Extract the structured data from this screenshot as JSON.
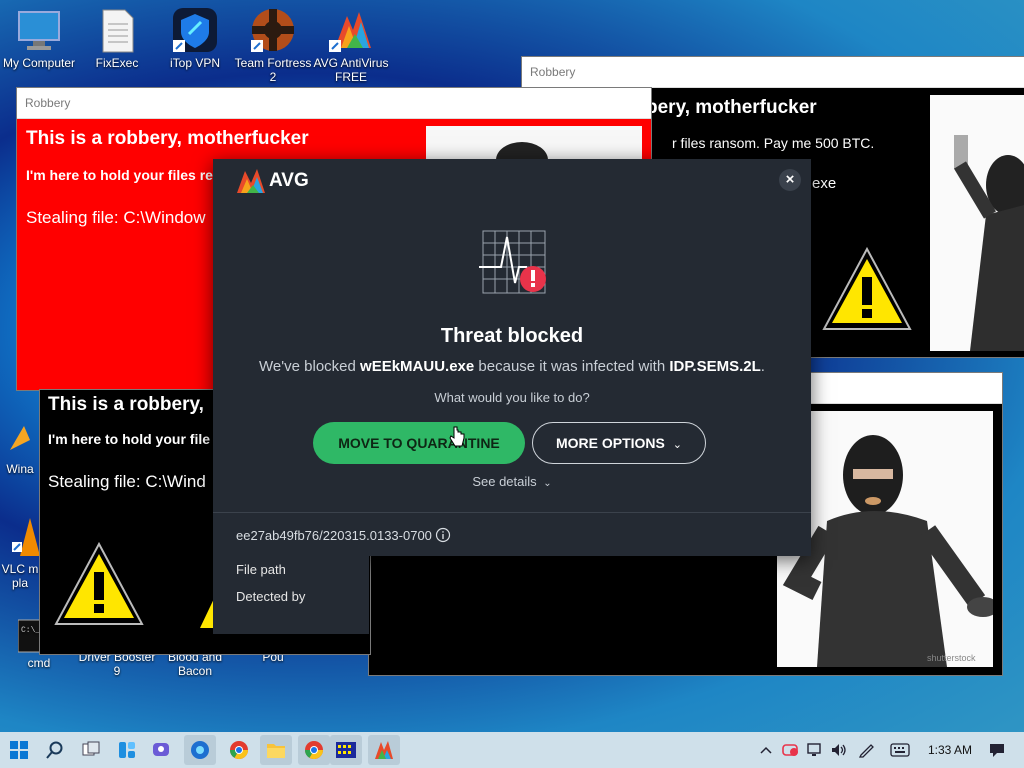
{
  "desktop_icons": [
    {
      "label": "My Computer"
    },
    {
      "label": "FixExec"
    },
    {
      "label": "iTop VPN"
    },
    {
      "label": "Team Fortress 2"
    },
    {
      "label": "AVG AntiVirus FREE"
    },
    {
      "label": "Wina"
    },
    {
      "label": "VLC m pla"
    },
    {
      "label": "cmd"
    },
    {
      "label": "Driver Booster 9"
    },
    {
      "label": "Blood and Bacon"
    },
    {
      "label": "Pou"
    }
  ],
  "robbery_windows": {
    "title": "Robbery",
    "heading_full": "This is a robbery, motherfucker",
    "heading_cut_right": "bery, motherfucker",
    "heading_cut_left": "This is a robbery,",
    "sub_cut_1": "I'm here to hold your files re",
    "sub_cut_2": "I'm here to hold your file",
    "sub_cut_right": "r files ransom. Pay me 500 BTC.",
    "stealing_1": "Stealing file: C:\\Window",
    "stealing_2": "Stealing file: C:\\Wind",
    "stealing_right_tail": "exe",
    "photo_watermark": "shutterstock"
  },
  "avg_dialog": {
    "brand": "AVG",
    "close": "×",
    "title": "Threat blocked",
    "msg_prefix": "We've blocked ",
    "file": "wEEkMAUU.exe",
    "msg_mid": " because it was infected with ",
    "threat": "IDP.SEMS.2L",
    "msg_suffix": ".",
    "question": "What would you like to do?",
    "primary_button": "MOVE TO QUARANTINE",
    "secondary_button": "MORE OPTIONS",
    "see_details": "See details",
    "id_text": "ee27ab49fb76/220315.0133-0700",
    "detail_labels": [
      "File path",
      "Detected by"
    ],
    "accent": "#2fb866",
    "alert": "#e8334a"
  },
  "taskbar": {
    "time": "1:33 AM"
  }
}
